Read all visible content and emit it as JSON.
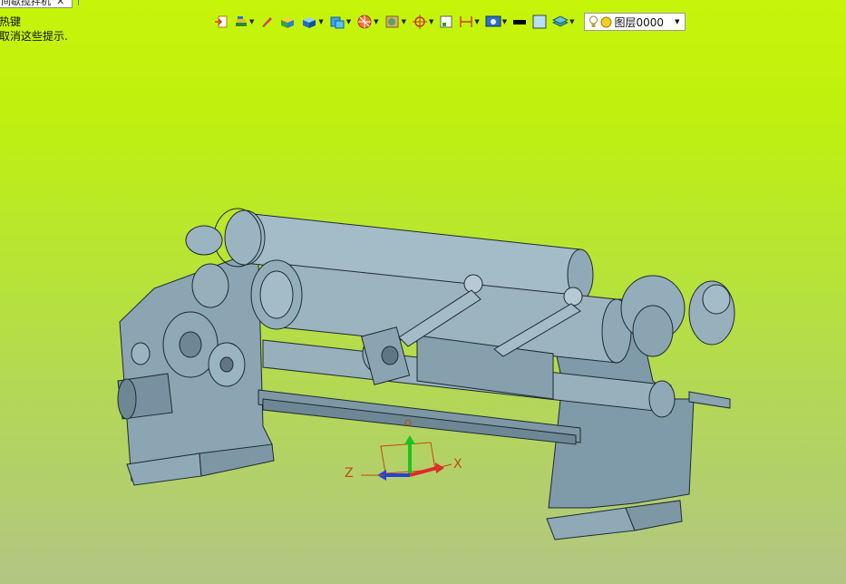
{
  "document_tab": {
    "title": "间歇搅拌机",
    "close_glyph": "✕"
  },
  "hint": {
    "line1": "热键",
    "line2": "取消这些提示."
  },
  "toolbar": {
    "buttons": [
      {
        "icon": "import-icon",
        "dropdown": false
      },
      {
        "icon": "layers-stack-icon",
        "dropdown": true
      },
      {
        "icon": "pen-icon",
        "dropdown": false
      },
      {
        "icon": "shaded-box-icon",
        "dropdown": false
      },
      {
        "icon": "display-mode-icon",
        "dropdown": true
      },
      {
        "icon": "view-cube-icon",
        "dropdown": true
      },
      {
        "icon": "render-sphere-icon",
        "dropdown": true
      },
      {
        "icon": "filter-icon",
        "dropdown": true
      },
      {
        "icon": "snap-target-icon",
        "dropdown": true
      },
      {
        "icon": "select-box-icon",
        "dropdown": false
      },
      {
        "icon": "dimension-icon",
        "dropdown": true
      },
      {
        "icon": "display-settings-icon",
        "dropdown": true
      },
      {
        "icon": "line-color-icon",
        "dropdown": false
      },
      {
        "icon": "fill-color-icon",
        "dropdown": false
      },
      {
        "icon": "layer-manager-icon",
        "dropdown": true
      }
    ],
    "layer_select": {
      "value": "图层0000"
    }
  },
  "triad": {
    "x_label": "X",
    "z_label": "Z"
  },
  "colors": {
    "background_top": "#c6f50a",
    "background_bottom": "#b2c684",
    "model_body": "#8fa9b7",
    "model_edge": "#1e2a30",
    "axis_x": "#e02a2a",
    "axis_y": "#1ec21e",
    "axis_z": "#2a3fd8",
    "axis_label": "#c04a10"
  }
}
